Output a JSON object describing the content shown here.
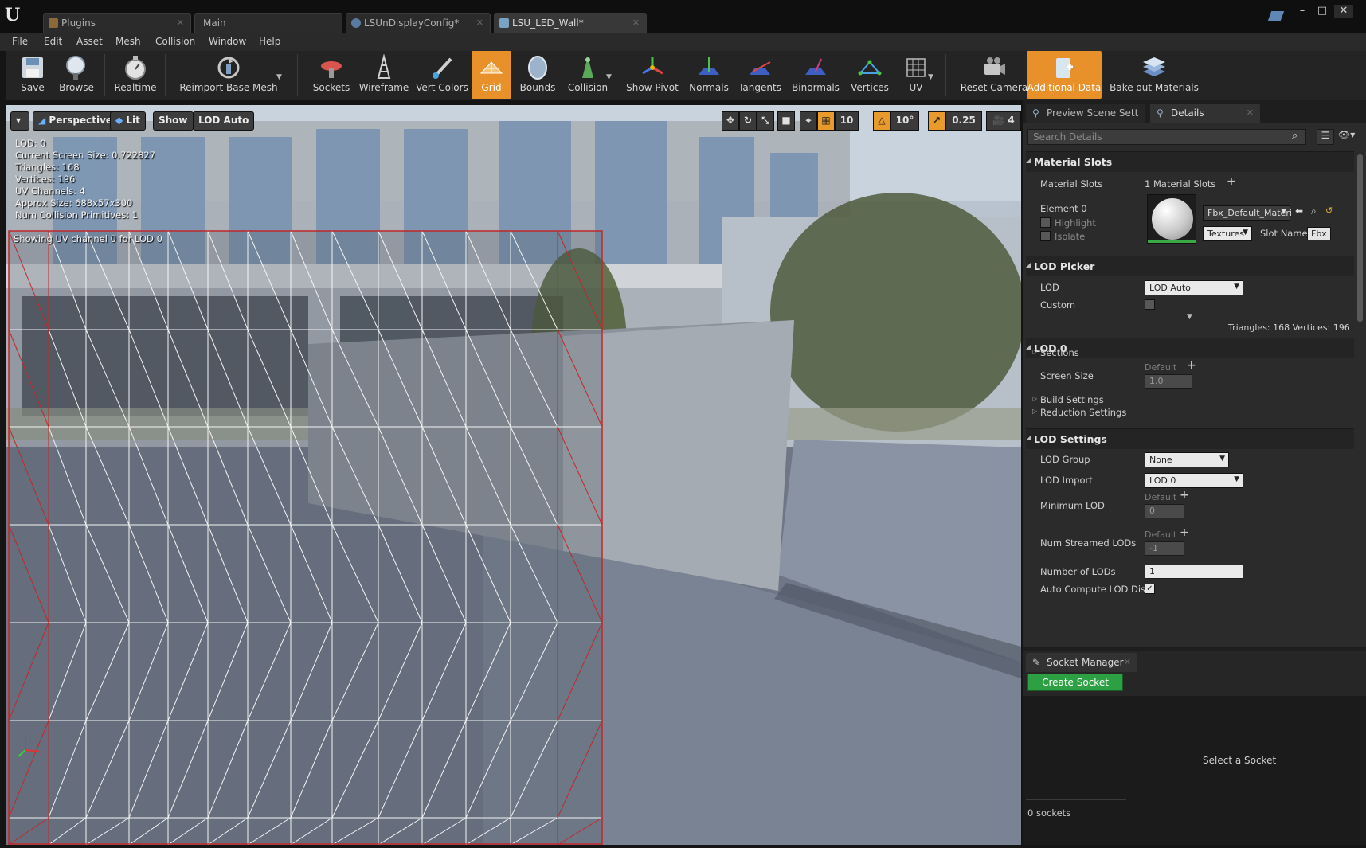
{
  "tabs": [
    {
      "label": "Plugins",
      "active": false
    },
    {
      "label": "Main",
      "active": false
    },
    {
      "label": "LSUnDisplayConfig*",
      "active": false
    },
    {
      "label": "LSU_LED_Wall*",
      "active": true
    }
  ],
  "window": {
    "minimize": "–",
    "maximize": "□",
    "close": "✕"
  },
  "menu": [
    "File",
    "Edit",
    "Asset",
    "Mesh",
    "Collision",
    "Window",
    "Help"
  ],
  "toolbar": {
    "save": "Save",
    "browse": "Browse",
    "realtime": "Realtime",
    "reimport": "Reimport Base Mesh",
    "sockets": "Sockets",
    "wireframe": "Wireframe",
    "vert_colors": "Vert Colors",
    "grid": "Grid",
    "bounds": "Bounds",
    "collision": "Collision",
    "show_pivot": "Show Pivot",
    "normals": "Normals",
    "tangents": "Tangents",
    "binormals": "Binormals",
    "vertices": "Vertices",
    "uv": "UV",
    "reset_camera": "Reset Camera",
    "additional_data": "Additional Data",
    "bake_out": "Bake out Materials"
  },
  "viewport": {
    "perspective": "Perspective",
    "lit": "Lit",
    "show": "Show",
    "lod": "LOD Auto",
    "grid_snap": "10",
    "rot_snap": "10°",
    "scale_snap": "0.25",
    "cam_speed": "4",
    "stats": [
      "LOD:  0",
      "Current Screen Size:  0.722827",
      "Triangles:  168",
      "Vertices:  196",
      "UV Channels:  4",
      "Approx Size: 688x57x300",
      "Num Collision Primitives:  1"
    ],
    "uv_caption": "Showing UV channel 0 for LOD 0"
  },
  "panel_tabs": {
    "preview": "Preview Scene Sett",
    "details": "Details"
  },
  "details": {
    "search_placeholder": "Search Details",
    "material_slots": {
      "header": "Material Slots",
      "label": "Material Slots",
      "count": "1 Material Slots",
      "element": "Element 0",
      "highlight": "Highlight",
      "isolate": "Isolate",
      "material": "Fbx_Default_Materi",
      "textures": "Textures",
      "slot_name_label": "Slot Name",
      "slot_name": "Fbx"
    },
    "lod_picker": {
      "header": "LOD Picker",
      "lod_label": "LOD",
      "lod_value": "LOD Auto",
      "custom_label": "Custom",
      "tri_vert": "Triangles: 168    Vertices: 196"
    },
    "lod0": {
      "header": "LOD 0",
      "sections": "Sections",
      "screen_size": "Screen Size",
      "default": "Default",
      "screen_size_value": "1.0",
      "build": "Build Settings",
      "reduction": "Reduction Settings"
    },
    "lod_settings": {
      "header": "LOD Settings",
      "group_label": "LOD Group",
      "group_value": "None",
      "import_label": "LOD Import",
      "import_value": "LOD 0",
      "min_lod_label": "Minimum LOD",
      "min_lod_default": "Default",
      "min_lod_value": "0",
      "streamed_label": "Num Streamed LODs",
      "streamed_default": "Default",
      "streamed_value": "-1",
      "num_lods_label": "Number of LODs",
      "num_lods_value": "1",
      "auto_compute_label": "Auto Compute LOD Dista"
    }
  },
  "socket_manager": {
    "title": "Socket Manager",
    "create": "Create Socket",
    "empty": "Select a Socket",
    "count": "0 sockets"
  }
}
